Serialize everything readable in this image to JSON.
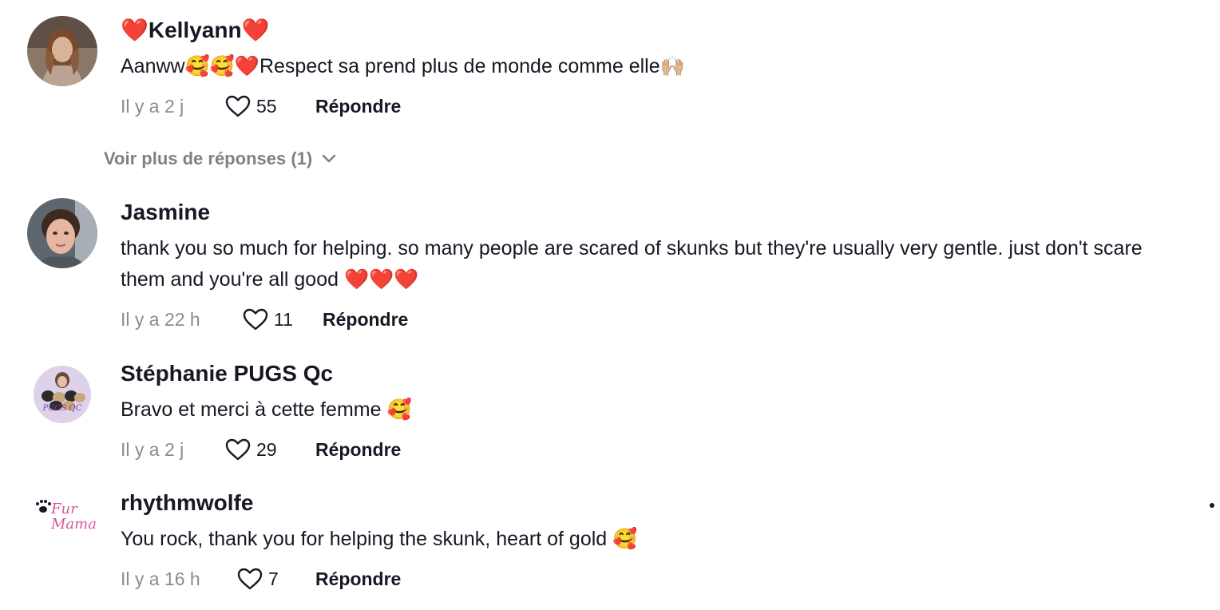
{
  "comments": [
    {
      "username": "❤️Kellyann❤️",
      "text": "Aanww🥰🥰❤️Respect sa prend plus de monde comme elle🙌🏼",
      "time": "Il y a 2 j",
      "likes": "55",
      "reply_label": "Répondre"
    },
    {
      "username": "Jasmine",
      "text": "thank you so much for helping. so many people are scared of skunks but they're usually very gentle. just don't scare them and you're all good ❤️❤️❤️",
      "time": "Il y a 22 h",
      "likes": "11",
      "reply_label": "Répondre"
    },
    {
      "username": "Stéphanie PUGS Qc",
      "text": "Bravo et merci à cette femme 🥰",
      "time": "Il y a 2 j",
      "likes": "29",
      "reply_label": "Répondre",
      "avatar_text": "PUGS QC"
    },
    {
      "username": "rhythmwolfe",
      "text": "You rock, thank you for helping the skunk, heart of gold 🥰",
      "time": "Il y a 16 h",
      "likes": "7",
      "reply_label": "Répondre",
      "avatar_text": "Fur Mama"
    }
  ],
  "more_replies": {
    "label": "Voir plus de réponses (1)"
  },
  "colors": {
    "text_primary": "#161823",
    "text_secondary": "#8a8b91",
    "avatar_pink": "#d9559b"
  },
  "icons": {
    "like": "heart-outline-icon",
    "expand": "chevron-down-icon"
  }
}
